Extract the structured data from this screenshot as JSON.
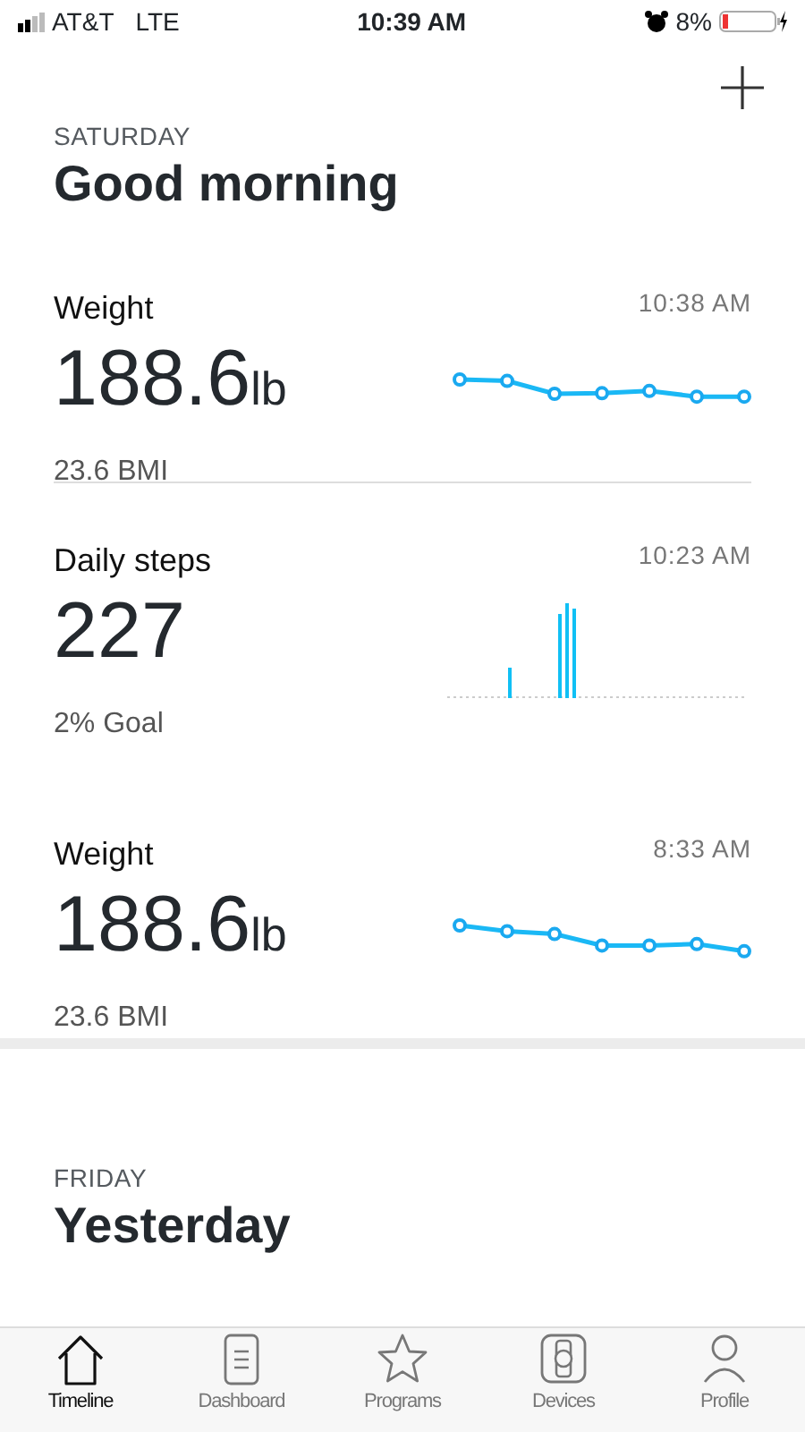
{
  "status_bar": {
    "carrier": "AT&T",
    "network": "LTE",
    "time": "10:39 AM",
    "battery": "8%"
  },
  "day": "SATURDAY",
  "greeting": "Good morning",
  "entries": [
    {
      "title": "Weight",
      "time": "10:38 AM",
      "value": "188.6",
      "unit": "lb",
      "detail": "23.6 BMI",
      "kind": "line"
    },
    {
      "title": "Daily steps",
      "time": "10:23 AM",
      "value": "227",
      "detail": "2% Goal",
      "kind": "bars"
    },
    {
      "title": "Weight",
      "time": "8:33 AM",
      "value": "188.6",
      "unit": "lb",
      "detail": "23.6 BMI",
      "kind": "line"
    }
  ],
  "next_day": {
    "day": "FRIDAY",
    "greeting": "Yesterday"
  },
  "tabs": [
    {
      "label": "Timeline",
      "selected": true
    },
    {
      "label": "Dashboard",
      "selected": false
    },
    {
      "label": "Programs",
      "selected": false
    },
    {
      "label": "Devices",
      "selected": false
    },
    {
      "label": "Profile",
      "selected": false
    }
  ]
}
